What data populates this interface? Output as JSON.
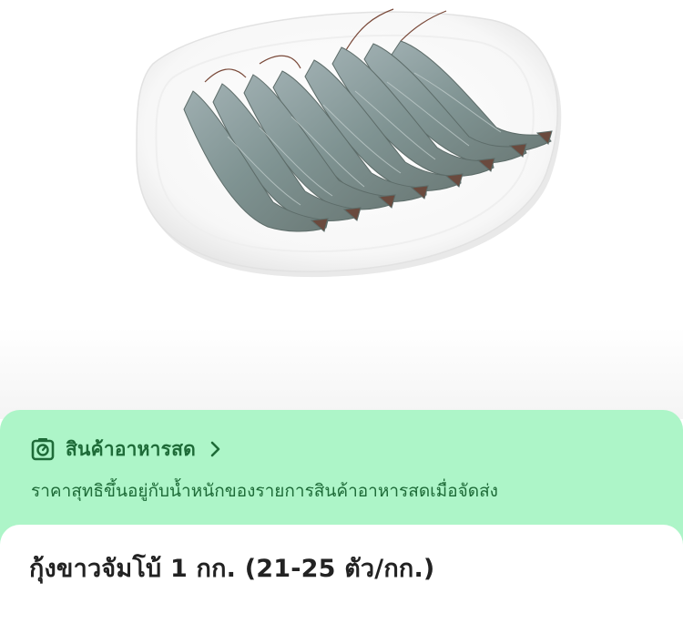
{
  "hero": {
    "image_icon": "shrimp-plate-image"
  },
  "fresh_banner": {
    "icon": "scale-icon",
    "title": "สินค้าอาหารสด",
    "chevron": "chevron-right-icon",
    "description": "ราคาสุทธิขึ้นอยู่กับน้ำหนักของรายการสินค้าอาหารสดเมื่อจัดส่ง",
    "background_color": "#adf5c8",
    "text_color": "#1e6b38"
  },
  "product": {
    "title": "กุ้งขาวจัมโบ้ 1 กก. (21-25 ตัว/กก.)"
  }
}
